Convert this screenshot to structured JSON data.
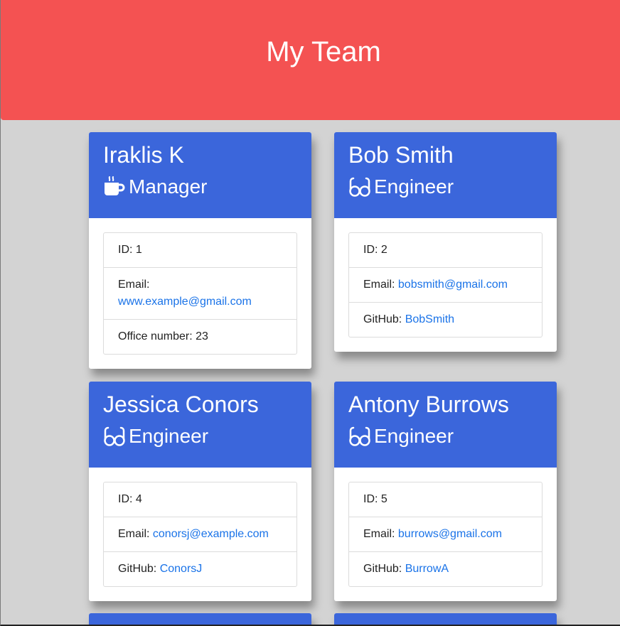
{
  "header": {
    "title": "My Team"
  },
  "labels": {
    "id": "ID: ",
    "email": "Email: ",
    "office": "Office number: ",
    "github": "GitHub: "
  },
  "team": [
    {
      "name": "Iraklis K",
      "role": "Manager",
      "icon": "coffee-icon",
      "id": "1",
      "email": "www.example@gmail.com",
      "office": "23"
    },
    {
      "name": "Bob Smith",
      "role": "Engineer",
      "icon": "glasses-icon",
      "id": "2",
      "email": "bobsmith@gmail.com",
      "github": "BobSmith"
    },
    {
      "name": "Jessica Conors",
      "role": "Engineer",
      "icon": "glasses-icon",
      "id": "4",
      "email": "conorsj@example.com",
      "github": "ConorsJ"
    },
    {
      "name": "Antony Burrows",
      "role": "Engineer",
      "icon": "glasses-icon",
      "id": "5",
      "email": "burrows@gmail.com",
      "github": "BurrowA"
    }
  ],
  "colors": {
    "header_bg": "#f45252",
    "card_header_bg": "#3b66db",
    "page_bg": "#d3d3d3",
    "link": "#1a73e8"
  }
}
